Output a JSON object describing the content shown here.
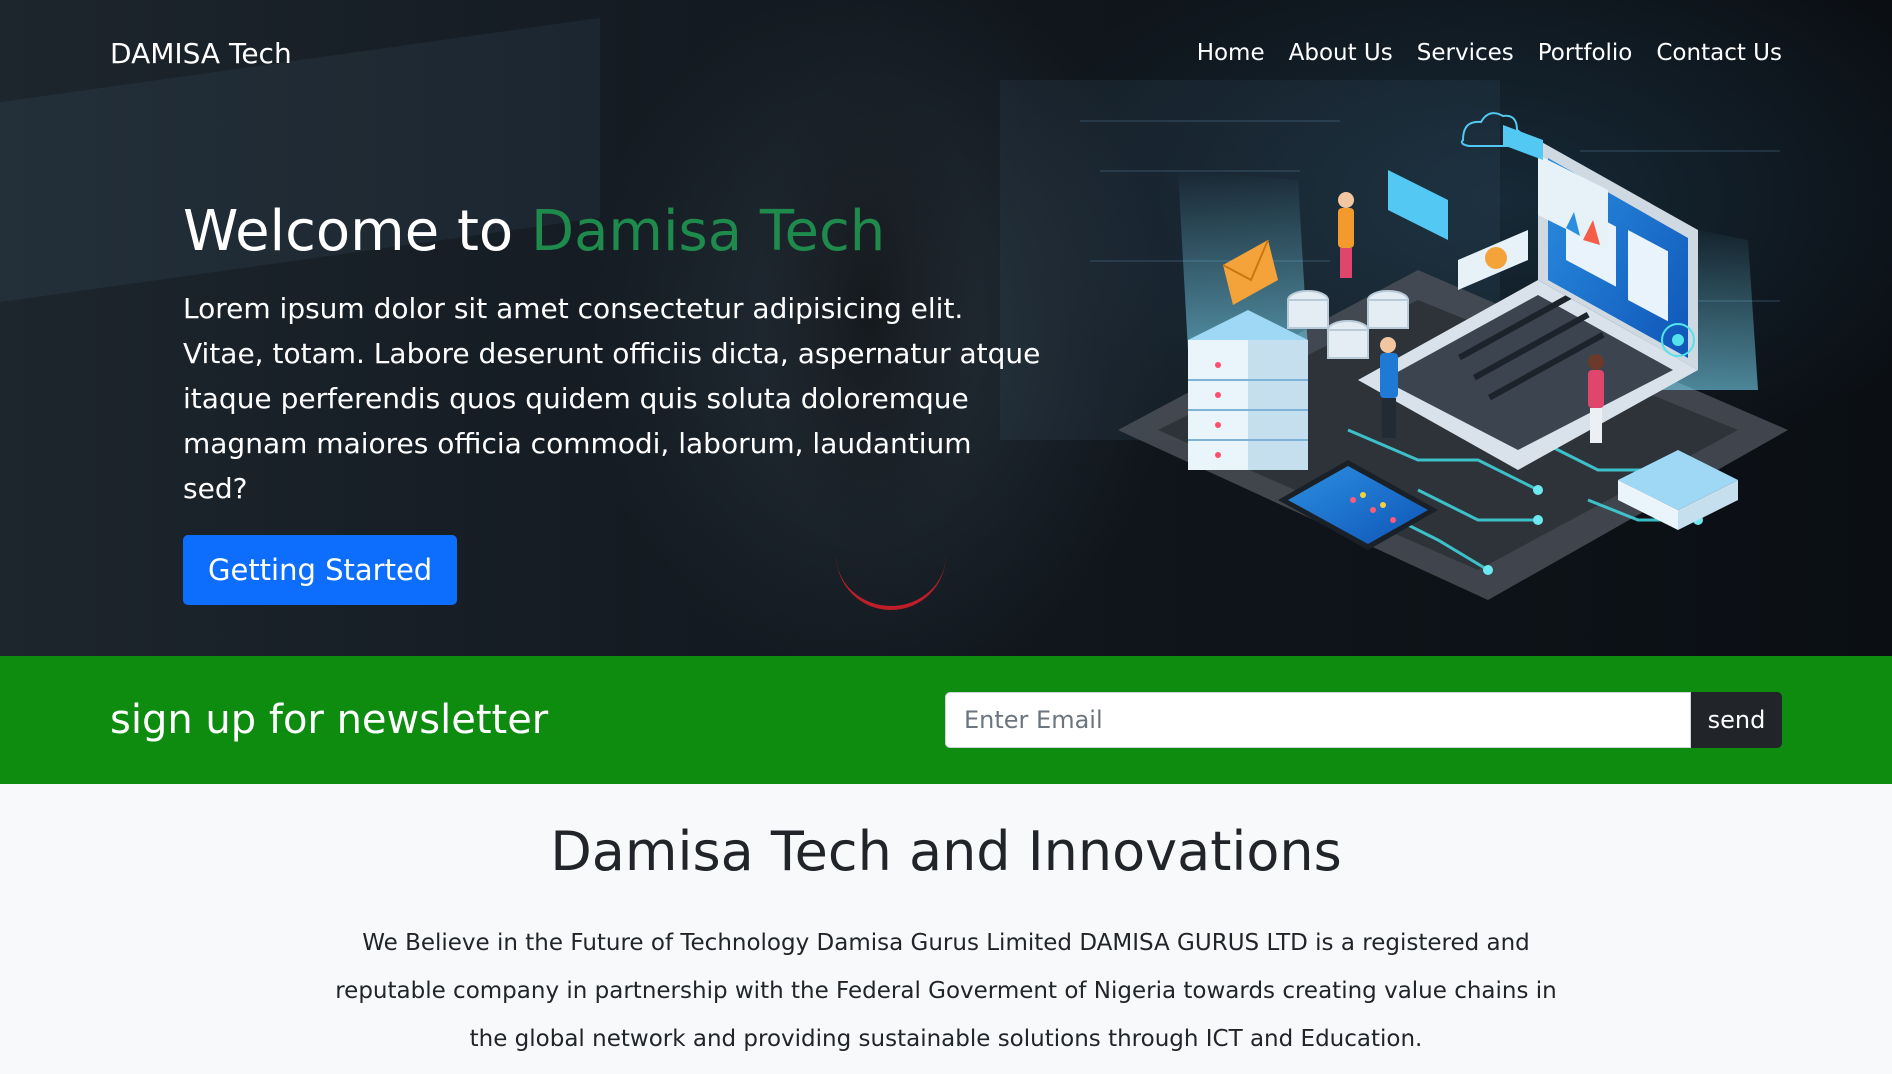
{
  "navbar": {
    "brand": "DAMISA Tech",
    "links": [
      "Home",
      "About Us",
      "Services",
      "Portfolio",
      "Contact Us"
    ]
  },
  "hero": {
    "title_prefix": "Welcome to ",
    "title_accent": "Damisa Tech",
    "paragraph": "Lorem ipsum dolor sit amet consectetur adipisicing elit. Vitae, totam. Labore deserunt officiis dicta, aspernatur atque itaque perferendis quos quidem quis soluta doloremque magnam maiores officia commodi, laborum, laudantium sed?",
    "cta_label": "Getting Started"
  },
  "newsletter": {
    "title": "sign up for newsletter",
    "email_placeholder": "Enter Email",
    "send_label": "send"
  },
  "about": {
    "title": "Damisa Tech and Innovations",
    "text": "We Believe in the Future of Technology Damisa Gurus Limited DAMISA GURUS LTD is a registered and reputable company in partnership with the Federal Goverment of Nigeria towards creating value chains in the global network and providing sustainable solutions through ICT and Education."
  },
  "colors": {
    "accent_green": "#1e8a4c",
    "newsletter_bg": "#0e8c10",
    "button_primary": "#0d6efd",
    "button_dark": "#212529"
  }
}
